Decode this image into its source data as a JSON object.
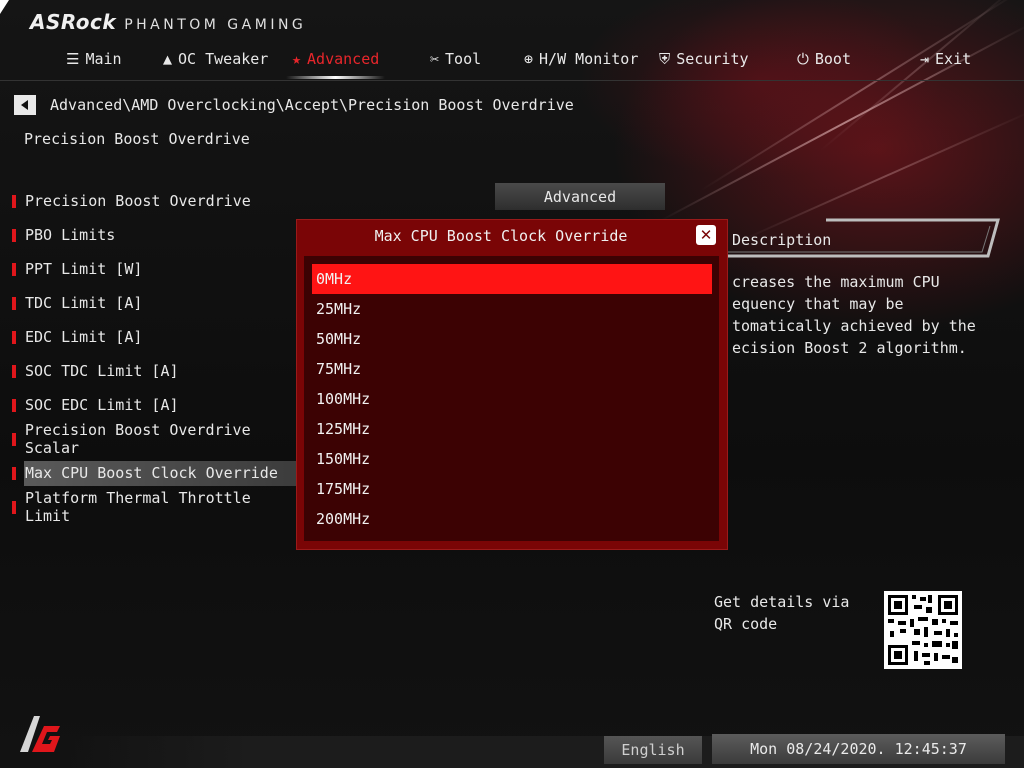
{
  "header": {
    "brand": "ASRock",
    "sub": "PHANTOM GAMING"
  },
  "tabs": [
    {
      "label": "Main",
      "icon": "list-icon",
      "glyph": "☰",
      "active": false
    },
    {
      "label": "OC Tweaker",
      "icon": "rocket-icon",
      "glyph": "🚀",
      "active": false
    },
    {
      "label": "Advanced",
      "icon": "star-icon",
      "glyph": "★",
      "active": true
    },
    {
      "label": "Tool",
      "icon": "tools-icon",
      "glyph": "✂",
      "active": false
    },
    {
      "label": "H/W Monitor",
      "icon": "crosshair-icon",
      "glyph": "⊕",
      "active": false
    },
    {
      "label": "Security",
      "icon": "shield-icon",
      "glyph": "⛨",
      "active": false
    },
    {
      "label": "Boot",
      "icon": "power-icon",
      "glyph": "⏻",
      "active": false
    },
    {
      "label": "Exit",
      "icon": "exit-icon",
      "glyph": "⇥",
      "active": false
    }
  ],
  "breadcrumb": "Advanced\\AMD Overclocking\\Accept\\Precision Boost Overdrive",
  "section_title": "Precision Boost Overdrive",
  "menu": {
    "items": [
      {
        "label": "Precision Boost Overdrive"
      },
      {
        "label": "PBO Limits"
      },
      {
        "label": "PPT Limit [W]"
      },
      {
        "label": "TDC Limit [A]"
      },
      {
        "label": "EDC Limit [A]"
      },
      {
        "label": "SOC TDC Limit [A]"
      },
      {
        "label": "SOC EDC Limit [A]"
      },
      {
        "label": "Precision Boost Overdrive Scalar"
      },
      {
        "label": "Max CPU Boost Clock Override",
        "selected": true
      },
      {
        "label": "Platform Thermal Throttle Limit"
      }
    ],
    "first_value": "Advanced"
  },
  "description": {
    "title": "Description",
    "text": "creases the maximum CPU\nequency that may be\ntomatically achieved by the\necision Boost 2 algorithm."
  },
  "dialog": {
    "title": "Max CPU Boost Clock Override",
    "options": [
      "0MHz",
      "25MHz",
      "50MHz",
      "75MHz",
      "100MHz",
      "125MHz",
      "150MHz",
      "175MHz",
      "200MHz"
    ],
    "selected_index": 0
  },
  "qr": {
    "label": "Get details via QR code"
  },
  "footer": {
    "language": "English",
    "datetime": "Mon 08/24/2020. 12:45:37"
  },
  "colors": {
    "accent": "#e0161b",
    "dialog_bg": "#7a0506",
    "dialog_list_bg": "#3c0203",
    "selected_option": "#ff1414"
  }
}
